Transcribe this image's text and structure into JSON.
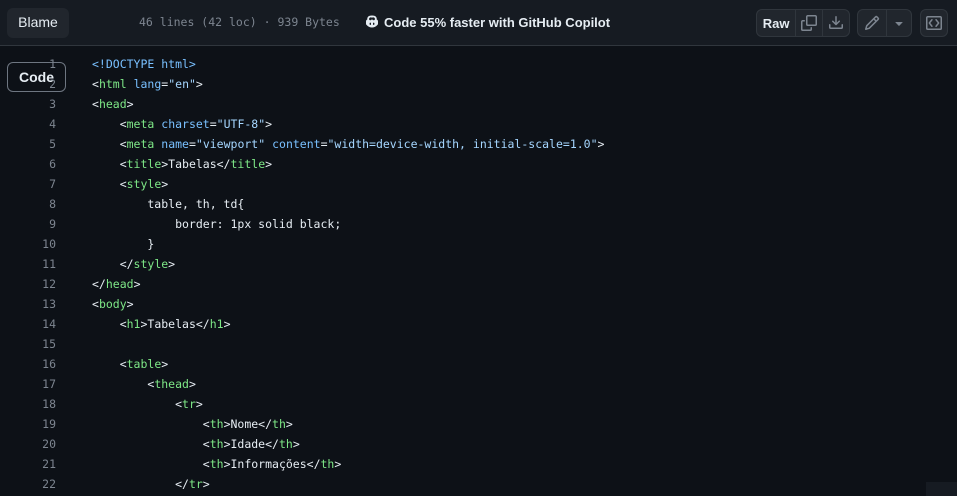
{
  "toolbar": {
    "tabs": [
      {
        "label": "Code",
        "active": true
      },
      {
        "label": "Blame",
        "active": false
      }
    ],
    "file_meta": "46 lines (42 loc) · 939 Bytes",
    "copilot_text": "Code 55% faster with GitHub Copilot",
    "raw_label": "Raw",
    "icons": [
      "copilot-icon",
      "copy-icon",
      "download-icon",
      "pencil-icon",
      "triangle-down-icon",
      "symbols-panel-icon"
    ]
  },
  "colors": {
    "background": "#0d1117",
    "toolbar": "#161b22",
    "tag": "#7ee787",
    "attribute": "#79c0ff",
    "string": "#a5d6ff",
    "line_number": "#7d8590"
  },
  "code": {
    "lines": [
      {
        "n": "1",
        "tokens": [
          [
            "a",
            "<!DOCTYPE html>"
          ]
        ]
      },
      {
        "n": "2",
        "tokens": [
          [
            "p",
            "<"
          ],
          [
            "t",
            "html"
          ],
          [
            "p",
            " "
          ],
          [
            "a",
            "lang"
          ],
          [
            "p",
            "="
          ],
          [
            "s",
            "\"en\""
          ],
          [
            "p",
            ">"
          ]
        ]
      },
      {
        "n": "3",
        "tokens": [
          [
            "p",
            "<"
          ],
          [
            "t",
            "head"
          ],
          [
            "p",
            ">"
          ]
        ]
      },
      {
        "n": "4",
        "tokens": [
          [
            "p",
            "    <"
          ],
          [
            "t",
            "meta"
          ],
          [
            "p",
            " "
          ],
          [
            "a",
            "charset"
          ],
          [
            "p",
            "="
          ],
          [
            "s",
            "\"UTF-8\""
          ],
          [
            "p",
            ">"
          ]
        ]
      },
      {
        "n": "5",
        "tokens": [
          [
            "p",
            "    <"
          ],
          [
            "t",
            "meta"
          ],
          [
            "p",
            " "
          ],
          [
            "a",
            "name"
          ],
          [
            "p",
            "="
          ],
          [
            "s",
            "\"viewport\""
          ],
          [
            "p",
            " "
          ],
          [
            "a",
            "content"
          ],
          [
            "p",
            "="
          ],
          [
            "s",
            "\"width=device-width, initial-scale=1.0\""
          ],
          [
            "p",
            ">"
          ]
        ]
      },
      {
        "n": "6",
        "tokens": [
          [
            "p",
            "    <"
          ],
          [
            "t",
            "title"
          ],
          [
            "p",
            ">Tabelas</"
          ],
          [
            "t",
            "title"
          ],
          [
            "p",
            ">"
          ]
        ]
      },
      {
        "n": "7",
        "tokens": [
          [
            "p",
            "    <"
          ],
          [
            "t",
            "style"
          ],
          [
            "p",
            ">"
          ]
        ]
      },
      {
        "n": "8",
        "tokens": [
          [
            "p",
            "        table, th, td{"
          ]
        ]
      },
      {
        "n": "9",
        "tokens": [
          [
            "p",
            "            border: 1px solid black;"
          ]
        ]
      },
      {
        "n": "10",
        "tokens": [
          [
            "p",
            "        }"
          ]
        ]
      },
      {
        "n": "11",
        "tokens": [
          [
            "p",
            "    </"
          ],
          [
            "t",
            "style"
          ],
          [
            "p",
            ">"
          ]
        ]
      },
      {
        "n": "12",
        "tokens": [
          [
            "p",
            "</"
          ],
          [
            "t",
            "head"
          ],
          [
            "p",
            ">"
          ]
        ]
      },
      {
        "n": "13",
        "tokens": [
          [
            "p",
            "<"
          ],
          [
            "t",
            "body"
          ],
          [
            "p",
            ">"
          ]
        ]
      },
      {
        "n": "14",
        "tokens": [
          [
            "p",
            "    <"
          ],
          [
            "t",
            "h1"
          ],
          [
            "p",
            ">Tabelas</"
          ],
          [
            "t",
            "h1"
          ],
          [
            "p",
            ">"
          ]
        ]
      },
      {
        "n": "15",
        "tokens": []
      },
      {
        "n": "16",
        "tokens": [
          [
            "p",
            "    <"
          ],
          [
            "t",
            "table"
          ],
          [
            "p",
            ">"
          ]
        ]
      },
      {
        "n": "17",
        "tokens": [
          [
            "p",
            "        <"
          ],
          [
            "t",
            "thead"
          ],
          [
            "p",
            ">"
          ]
        ]
      },
      {
        "n": "18",
        "tokens": [
          [
            "p",
            "            <"
          ],
          [
            "t",
            "tr"
          ],
          [
            "p",
            ">"
          ]
        ]
      },
      {
        "n": "19",
        "tokens": [
          [
            "p",
            "                <"
          ],
          [
            "t",
            "th"
          ],
          [
            "p",
            ">Nome</"
          ],
          [
            "t",
            "th"
          ],
          [
            "p",
            ">"
          ]
        ]
      },
      {
        "n": "20",
        "tokens": [
          [
            "p",
            "                <"
          ],
          [
            "t",
            "th"
          ],
          [
            "p",
            ">Idade</"
          ],
          [
            "t",
            "th"
          ],
          [
            "p",
            ">"
          ]
        ]
      },
      {
        "n": "21",
        "tokens": [
          [
            "p",
            "                <"
          ],
          [
            "t",
            "th"
          ],
          [
            "p",
            ">Informações</"
          ],
          [
            "t",
            "th"
          ],
          [
            "p",
            ">"
          ]
        ]
      },
      {
        "n": "22",
        "tokens": [
          [
            "p",
            "            </"
          ],
          [
            "t",
            "tr"
          ],
          [
            "p",
            ">"
          ]
        ]
      }
    ]
  }
}
